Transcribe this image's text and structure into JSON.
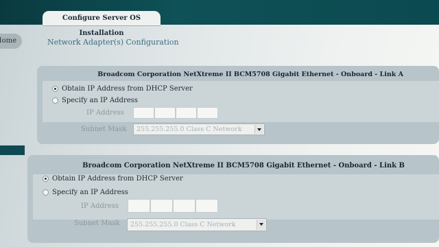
{
  "tab": {
    "label": "Configure Server OS Installation"
  },
  "nav": {
    "home_label": "Home"
  },
  "page": {
    "title": "Network Adapter(s) Configuration"
  },
  "adapters": [
    {
      "header": "Broadcom Corporation NetXtreme II BCM5708 Gigabit Ethernet - Onboard - Link A",
      "dhcp_label": "Obtain IP Address from DHCP Server",
      "static_label": "Specify an IP Address",
      "ip_label": "IP Address",
      "mask_label": "Subnet Mask",
      "mask_value": "255.255.255.0 Class C Network",
      "selected": "dhcp"
    },
    {
      "header": "Broadcom Corporation NetXtreme II BCM5708 Gigabit Ethernet - Onboard - Link B",
      "dhcp_label": "Obtain IP Address from DHCP Server",
      "static_label": "Specify an IP Address",
      "ip_label": "IP Address",
      "mask_label": "Subnet Mask",
      "mask_value": "255.255.255.0 Class C Network",
      "selected": "dhcp"
    }
  ]
}
